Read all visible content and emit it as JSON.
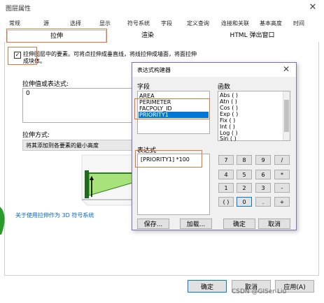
{
  "main": {
    "title": "图层属性",
    "tabs_row1": [
      "常规",
      "源",
      "选择",
      "显示",
      "符号系统",
      "字段",
      "定义查询",
      "连接和关联",
      "基本高度",
      "时间"
    ],
    "tabs_row2": [
      "拉伸",
      "渲染",
      "HTML 弹出窗口"
    ],
    "extrude_checkbox_label_line1": "拉伸图层中的要素。可将点拉伸成垂直线，将线拉伸成墙面，将面拉伸",
    "extrude_checkbox_label_line2": "成块体。",
    "value_label": "拉伸值或表达式:",
    "value": "0",
    "method_label": "拉伸方式:",
    "method_value": "将其添加到各要素的最小高度",
    "help_link": "关于使用拉伸作为 3D 符号系统",
    "buttons": {
      "ok": "确定",
      "cancel": "取消",
      "apply": "应用(A)"
    },
    "watermark": "CSDN @GISer Liu",
    "colors": {
      "highlight_border": "#e2733a",
      "selection": "#0078d7",
      "link": "#0066cc"
    }
  },
  "builder": {
    "title": "表达式构建器",
    "fields_label": "字段",
    "fields": [
      "AREA",
      "PERIMETER",
      "FACPOLY_ID",
      "PRIORITY1"
    ],
    "selected_field": "PRIORITY1",
    "functions_label": "函数",
    "functions": [
      "Abs ( )",
      "Atn ( )",
      "Cos ( )",
      "Exp ( )",
      "Fix ( )",
      "Int ( )",
      "Log ( )",
      "Sin ( )"
    ],
    "expression_label": "表达式",
    "expression": "[PRIORITY1] *100",
    "keypad": [
      "7",
      "8",
      "9",
      "/",
      "4",
      "5",
      "6",
      "*",
      "1",
      "2",
      "3",
      "-",
      "( )",
      "0",
      ".",
      "+"
    ],
    "buttons": {
      "save": "保存...",
      "load": "加载...",
      "ok": "确定",
      "cancel": "取消"
    }
  }
}
